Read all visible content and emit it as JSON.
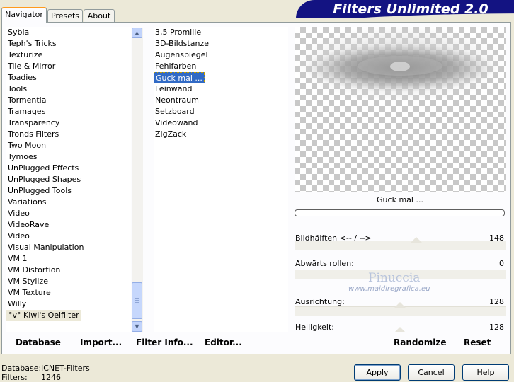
{
  "banner": {
    "title": "Filters Unlimited 2.0"
  },
  "tabs": [
    {
      "label": "Navigator",
      "active": true
    },
    {
      "label": "Presets",
      "active": false
    },
    {
      "label": "About",
      "active": false
    }
  ],
  "categories": [
    "Sybia",
    "Teph's Tricks",
    "Texturize",
    "Tile & Mirror",
    "Toadies",
    "Tools",
    "Tormentia",
    "Tramages",
    "Transparency",
    "Tronds Filters",
    "Two Moon",
    "Tymoes",
    "UnPlugged Effects",
    "UnPlugged Shapes",
    "UnPlugged Tools",
    "Variations",
    "Video",
    "VideoRave",
    "Video",
    "Visual Manipulation",
    "VM 1",
    "VM Distortion",
    "VM Stylize",
    "VM Texture",
    "Willy",
    "°v° Kiwi's Oelfilter"
  ],
  "current_category_index": 25,
  "filters": [
    "3,5 Promille",
    "3D-Bildstanze",
    "Augenspiegel",
    "Fehlfarben",
    "Guck mal ...",
    "Leinwand",
    "Neontraum",
    "Setzboard",
    "Videowand",
    "ZigZack"
  ],
  "selected_filter_index": 4,
  "preview": {
    "filter_name": "Guck mal ...",
    "watermark_line1": "Pinuccia",
    "watermark_line2": "www.maidiregrafica.eu"
  },
  "controls": [
    {
      "label": "Bildhälften <-- / -->",
      "value": "148",
      "level": 148
    },
    {
      "label": "Abwärts rollen:",
      "value": "0",
      "level": 0
    },
    {
      "label": "Ausrichtung:",
      "value": "128",
      "level": 128
    },
    {
      "label": "Helligkeit:",
      "value": "128",
      "level": 128
    }
  ],
  "toolbar": {
    "database": "Database",
    "import": "Import...",
    "filter_info": "Filter Info...",
    "editor": "Editor...",
    "randomize": "Randomize",
    "reset": "Reset"
  },
  "status": {
    "database_label": "Database:",
    "database_value": "ICNET-Filters",
    "filters_label": "Filters:",
    "filters_value": "1246"
  },
  "buttons": {
    "apply": "Apply",
    "cancel": "Cancel",
    "help": "Help"
  },
  "colors": {
    "banner": "#131382",
    "selection": "#316ac5",
    "tab_highlight": "#ff9a1d"
  }
}
